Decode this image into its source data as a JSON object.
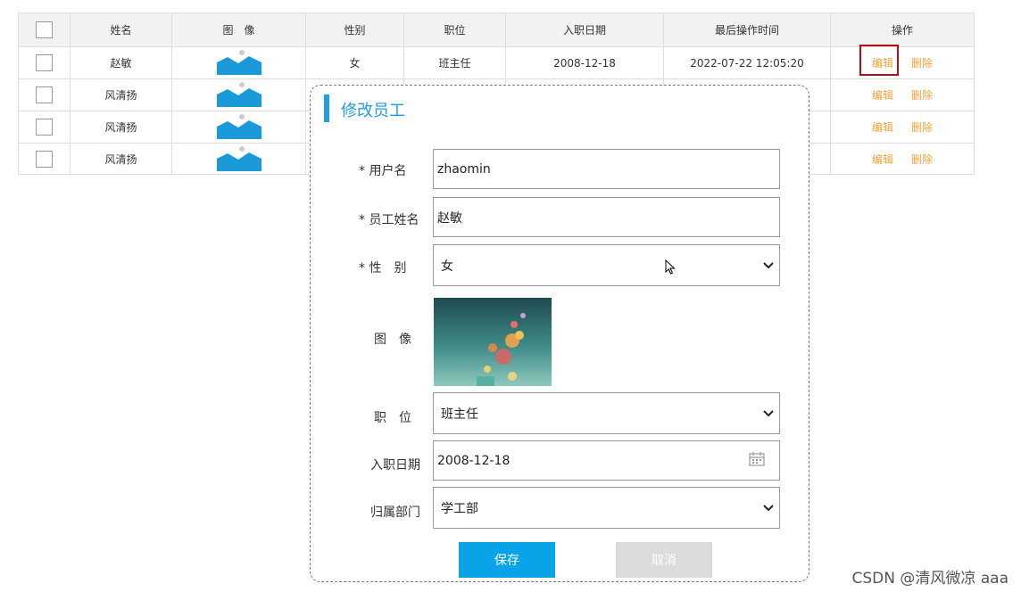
{
  "table": {
    "headers": [
      "",
      "姓名",
      "图　像",
      "性别",
      "职位",
      "入职日期",
      "最后操作时间",
      "操作"
    ],
    "rows": [
      {
        "name": "赵敏",
        "gender": "女",
        "position": "班主任",
        "hire_date": "2008-12-18",
        "last_op": "2022-07-22 12:05:20",
        "edit": "编辑",
        "delete": "删除"
      },
      {
        "name": "风清扬",
        "edit": "编辑",
        "delete": "删除"
      },
      {
        "name": "风清扬",
        "edit": "编辑",
        "delete": "删除"
      },
      {
        "name": "风清扬",
        "edit": "编辑",
        "delete": "删除"
      }
    ],
    "image_icon": "image-placeholder-icon"
  },
  "modal": {
    "title": "修改员工",
    "username_label": "* 用户名",
    "username_value": "zhaomin",
    "fullname_label": "* 员工姓名",
    "fullname_value": "赵敏",
    "gender_label": "* 性　别",
    "gender_value": "女",
    "photo_label": "图　像",
    "position_label": "职　位",
    "position_value": "班主任",
    "hire_date_label": "入职日期",
    "hire_date_value": "2008-12-18",
    "dept_label": "归属部门",
    "dept_value": "学工部",
    "save_label": "保存",
    "cancel_label": "取消"
  },
  "watermark": "CSDN @清风微凉 aaa",
  "colors": {
    "accent": "#1e9ee3",
    "save": "#0ba3e8",
    "link": "#f2a33a",
    "highlight": "#b40e10"
  }
}
